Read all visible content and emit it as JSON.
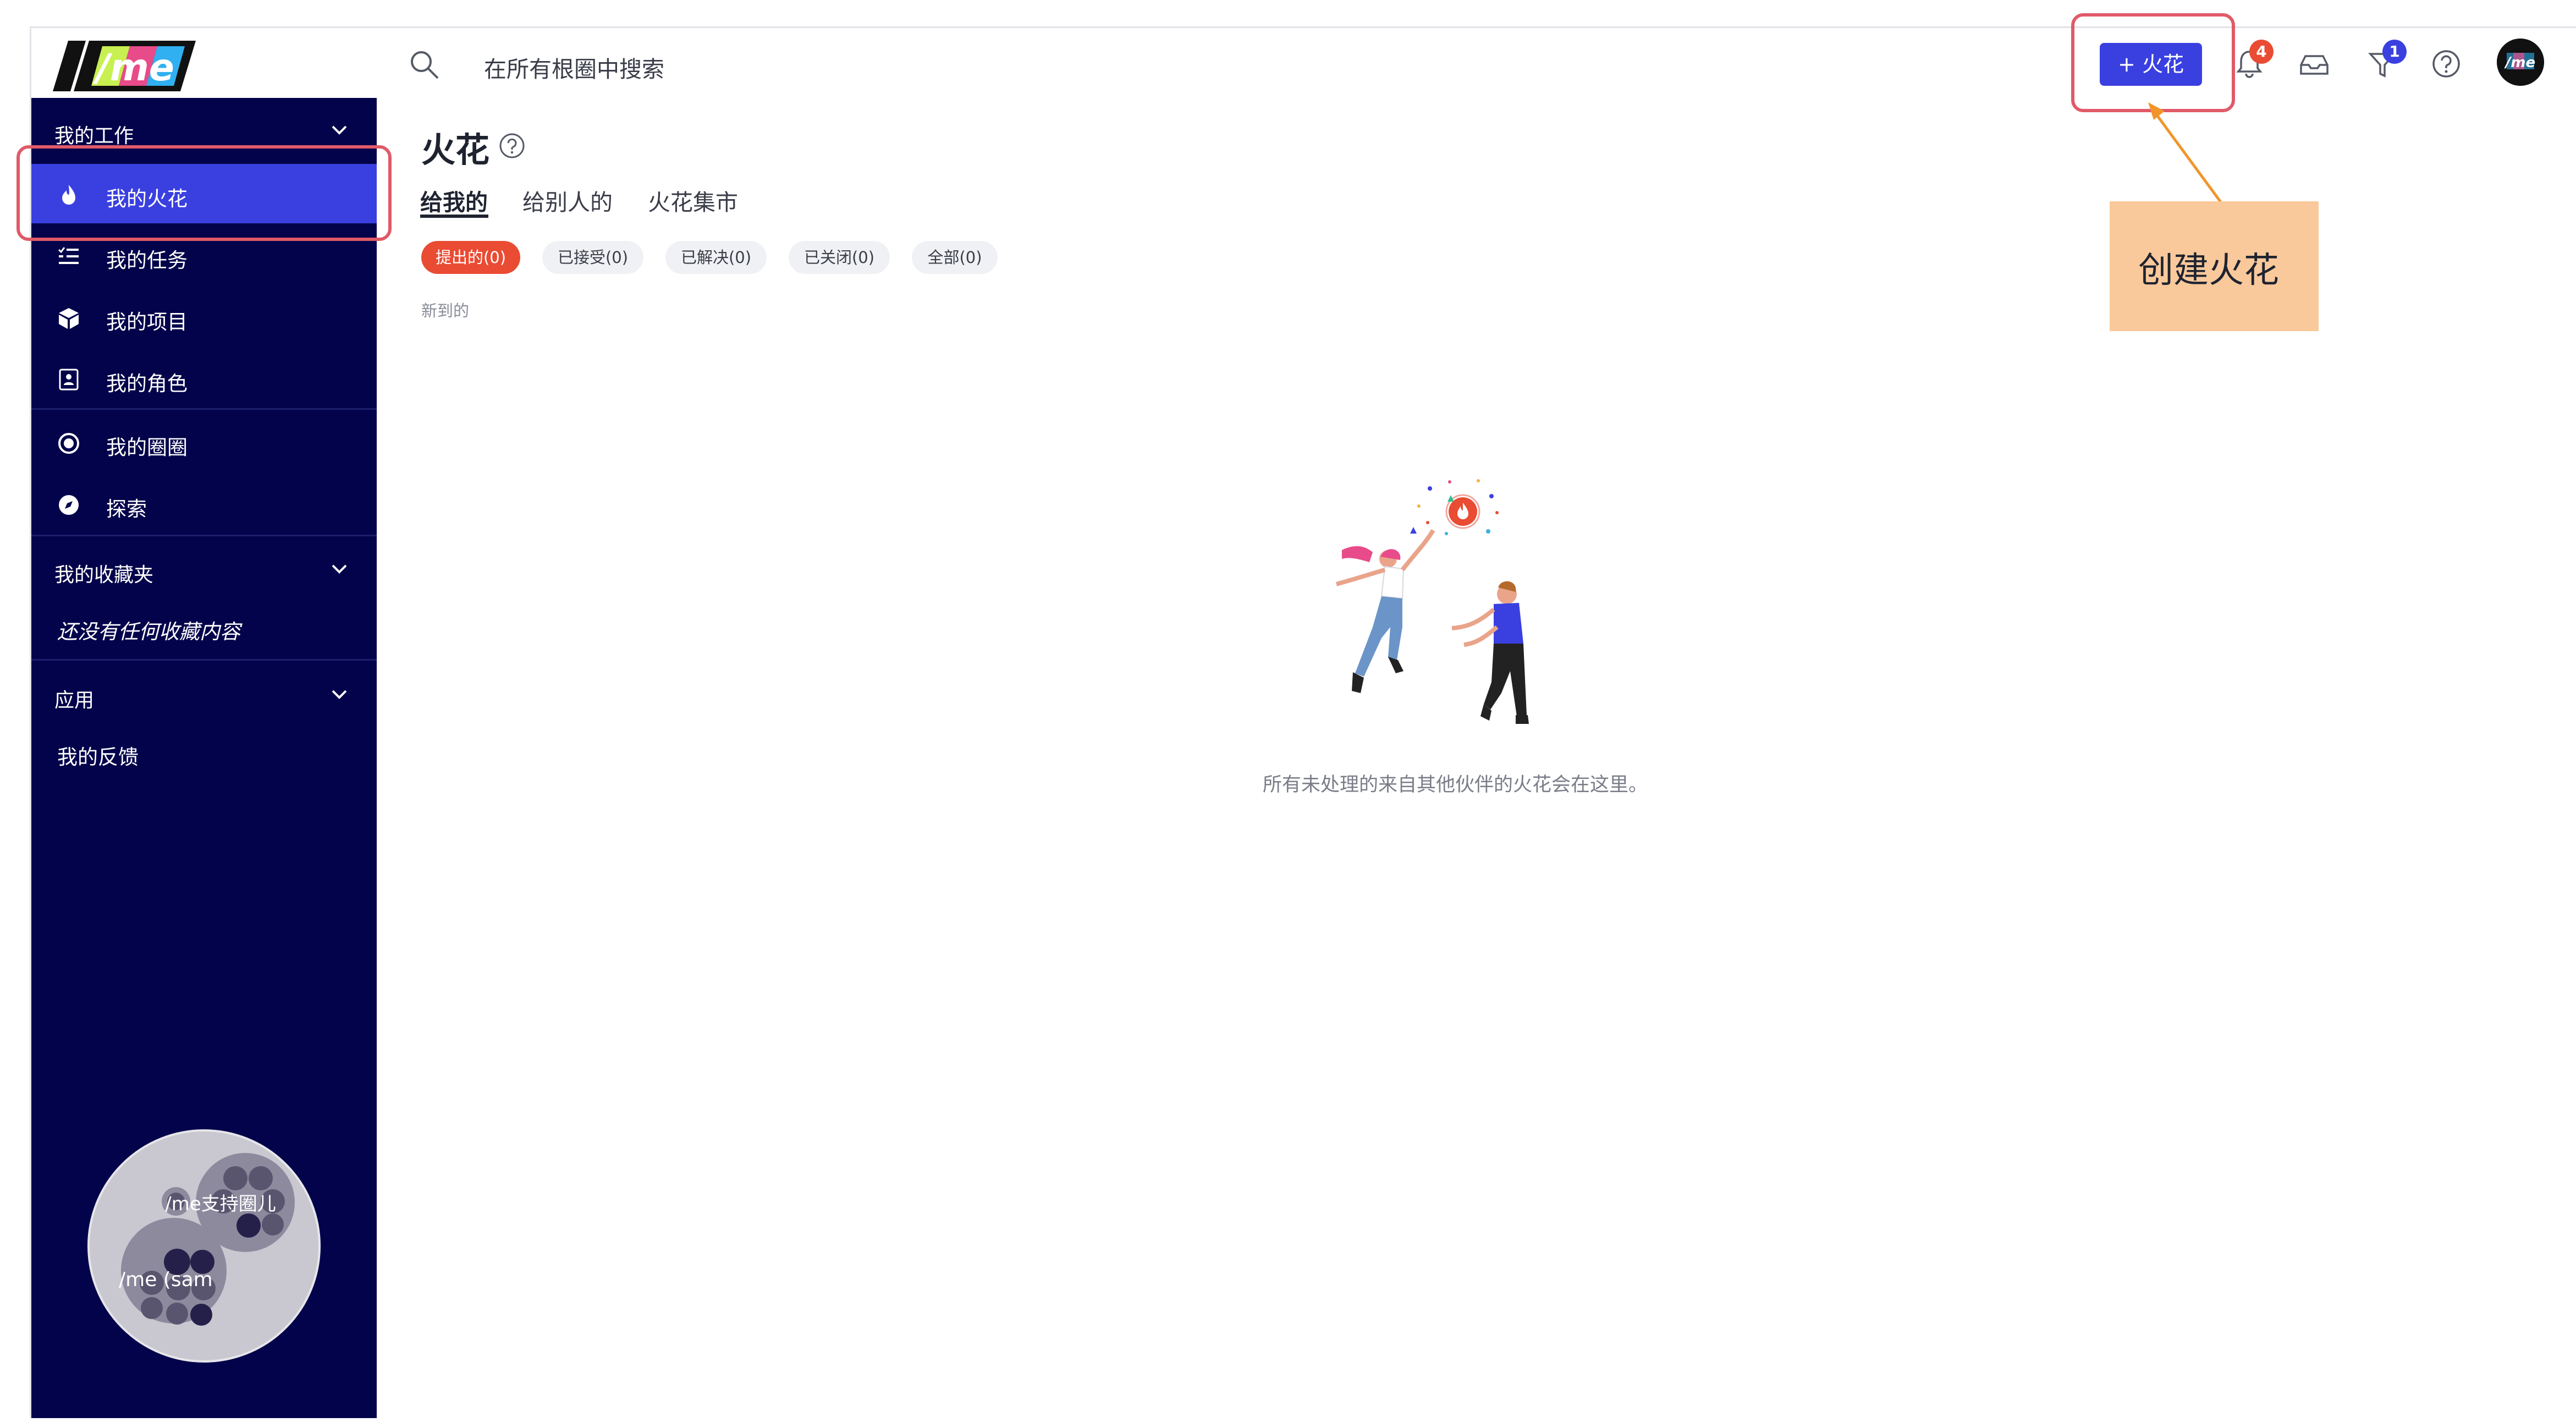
{
  "app": {
    "logo_text": "/me",
    "avatar_text": "/me"
  },
  "search": {
    "placeholder": "在所有根圈中搜索"
  },
  "header": {
    "create_button": "+ 火花",
    "notifications_count": "4",
    "filter_count": "1",
    "icons": [
      "search-icon",
      "bell-icon",
      "inbox-icon",
      "filter-icon",
      "help-icon"
    ]
  },
  "sidebar": {
    "my_work": {
      "title": "我的工作",
      "items": [
        {
          "label": "我的火花",
          "icon": "flame-icon",
          "active": true
        },
        {
          "label": "我的任务",
          "icon": "tasks-icon"
        },
        {
          "label": "我的项目",
          "icon": "cube-icon"
        },
        {
          "label": "我的角色",
          "icon": "role-card-icon"
        },
        {
          "label": "我的圈圈",
          "icon": "circle-target-icon"
        },
        {
          "label": "探索",
          "icon": "compass-icon"
        }
      ]
    },
    "favorites": {
      "title": "我的收藏夹",
      "empty": "还没有任何收藏内容"
    },
    "apps": {
      "title": "应用",
      "items": [
        "我的反馈"
      ]
    },
    "circles_map": {
      "label_top": "/me支持圈儿",
      "label_left": "/me (sam"
    }
  },
  "main": {
    "title": "火花",
    "tabs": [
      "给我的",
      "给别人的",
      "火花集市"
    ],
    "filters": [
      "提出的(0)",
      "已接受(0)",
      "已解决(0)",
      "已关闭(0)",
      "全部(0)"
    ],
    "caption": "新到的",
    "empty_message": "所有未处理的来自其他伙伴的火花会在这里。"
  },
  "annotation": {
    "text": "创建火花"
  },
  "colors": {
    "sidebar_bg": "#03034b",
    "active_bg": "#3a40e0",
    "accent_red": "#ea4b33",
    "highlight": "#e05a68",
    "note_bg": "#f9c99b"
  }
}
